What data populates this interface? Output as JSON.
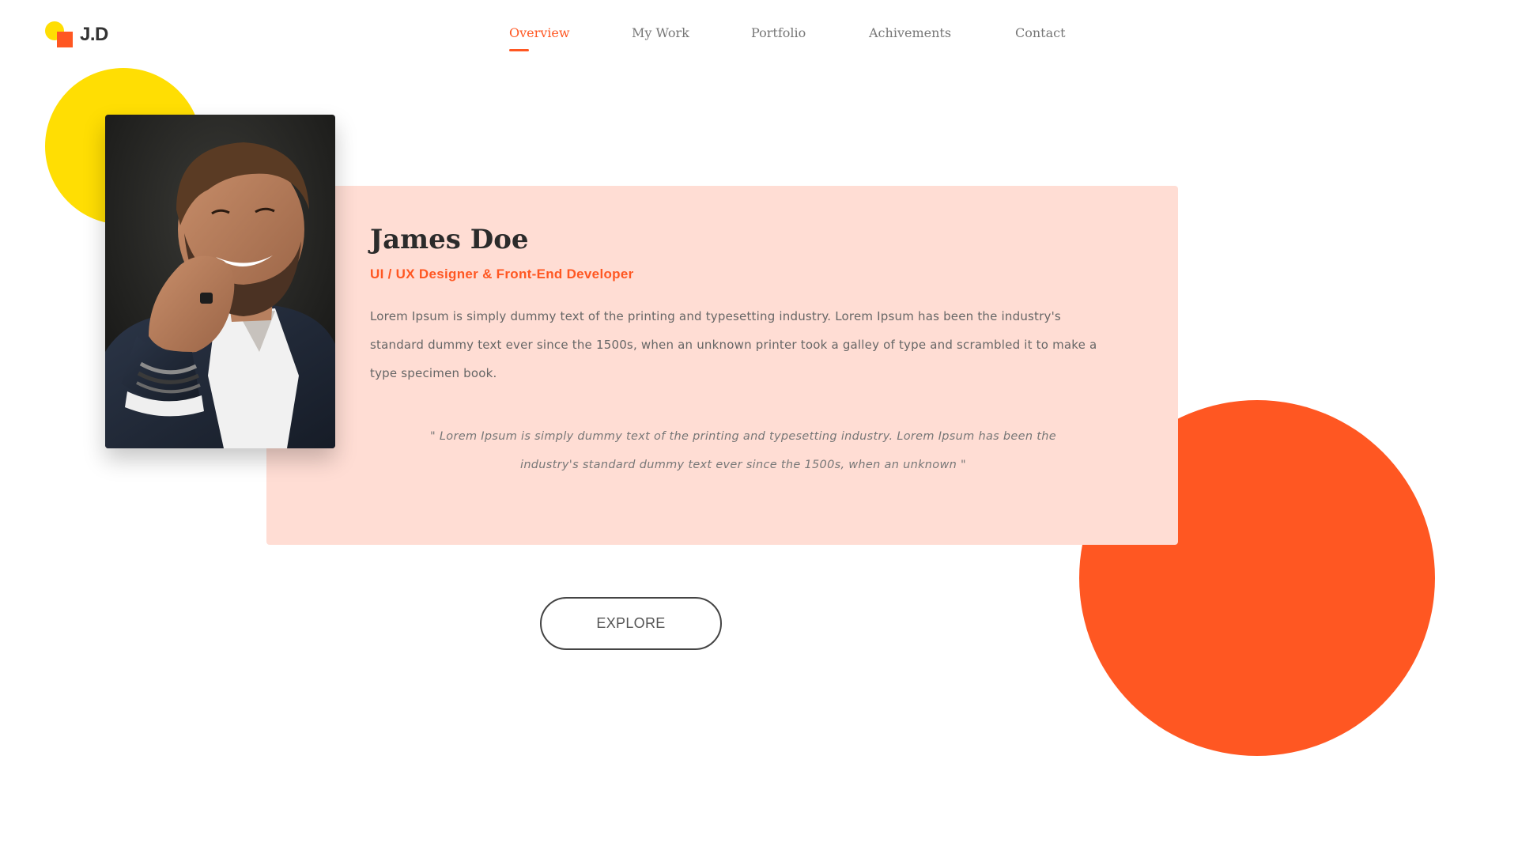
{
  "logo": {
    "text": "J.D"
  },
  "nav": {
    "items": [
      {
        "label": "Overview",
        "active": true
      },
      {
        "label": "My Work"
      },
      {
        "label": "Portfolio"
      },
      {
        "label": "Achivements"
      },
      {
        "label": "Contact"
      }
    ]
  },
  "profile": {
    "name": "James Doe",
    "role": "UI / UX Designer & Front-End Developer",
    "bio": "Lorem Ipsum is simply dummy text of the printing and typesetting industry. Lorem Ipsum has been the industry's standard dummy text ever since the 1500s, when an unknown printer took a galley of type and scrambled it to make a type specimen book.",
    "quote": "\" Lorem Ipsum is simply dummy text of the printing and typesetting industry. Lorem Ipsum has been the industry's standard dummy text ever since the 1500s, when an unknown \""
  },
  "cta": {
    "label": "EXPLORE"
  },
  "colors": {
    "accent": "#FF5722",
    "yellow": "#FFDE03",
    "card_bg": "#FFDDD4",
    "text_dark": "#2b2b2b",
    "text_muted": "#777777"
  }
}
